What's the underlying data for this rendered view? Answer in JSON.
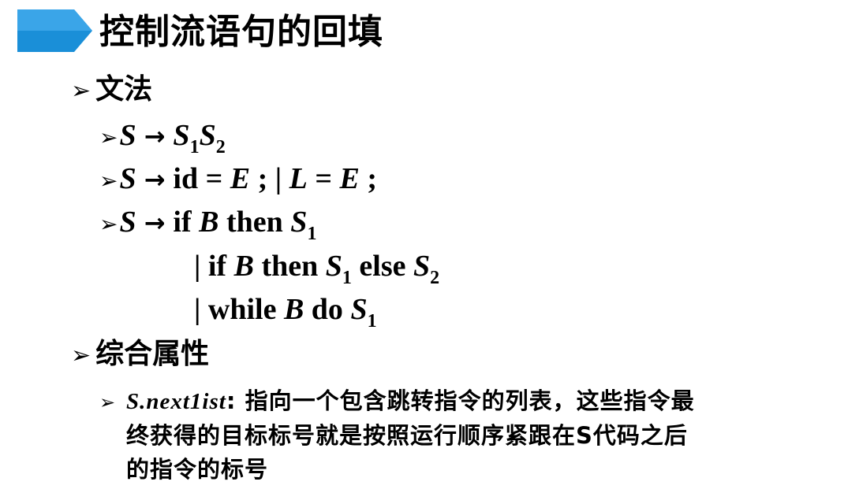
{
  "title": "控制流语句的回填",
  "sections": {
    "grammar": {
      "bullet": "➢",
      "label": "文法"
    },
    "synth": {
      "bullet": "➢",
      "label": "综合属性"
    }
  },
  "rules": {
    "r1": {
      "lhs": "S",
      "arrow": "→",
      "s1": "S",
      "s1_sub": "1",
      "s2": "S",
      "s2_sub": "2"
    },
    "r2": {
      "lhs": "S",
      "arrow": "→",
      "id": "id",
      "eq1": "=",
      "e1": "E",
      "semi1": ";",
      "bar": "|",
      "l": "L",
      "eq2": "=",
      "e2": "E",
      "semi2": ";"
    },
    "r3": {
      "lhs": "S",
      "arrow": "→",
      "if": "if",
      "b": "B",
      "then": "then",
      "s": "S",
      "s_sub": "1"
    },
    "r4": {
      "bar": "|",
      "if": "if",
      "b": "B",
      "then": "then",
      "s1": "S",
      "s1_sub": "1",
      "else": "else",
      "s2": "S",
      "s2_sub": "2"
    },
    "r5": {
      "bar": "|",
      "while": "while",
      "b": "B",
      "do": "do",
      "s": "S",
      "s_sub": "1"
    }
  },
  "attribute": {
    "name": "S.next1ist",
    "colon": ":",
    "line1": "指向一个包含跳转指令的列表，这些指令最",
    "line2": "终获得的目标标号就是按照运行顺序紧跟在S代码之后",
    "line3": "的指令的标号"
  },
  "colors": {
    "accent": "#1a8fd8",
    "text": "#000000"
  },
  "icons": {
    "title_marker": "blue-arrow-banner-icon",
    "bullet": "arrowhead-bullet-icon"
  }
}
